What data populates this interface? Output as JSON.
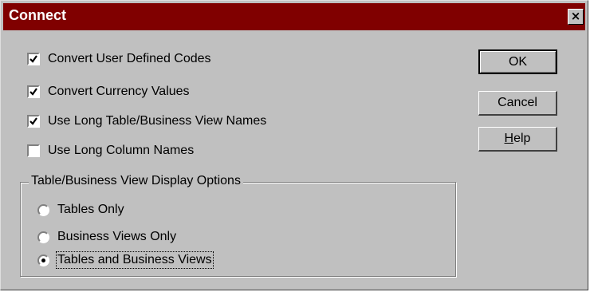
{
  "window": {
    "title": "Connect",
    "close_glyph": "×"
  },
  "options": {
    "checkboxes": [
      {
        "label": "Convert User Defined Codes",
        "checked": true
      },
      {
        "label": "Convert Currency Values",
        "checked": true
      },
      {
        "label": "Use Long Table/Business View Names",
        "checked": true
      },
      {
        "label": "Use Long Column Names",
        "checked": false
      }
    ]
  },
  "buttons": {
    "ok": "OK",
    "cancel": "Cancel",
    "help_mnemonic": "H",
    "help_rest": "elp"
  },
  "display_options": {
    "title": "Table/Business View Display Options",
    "radios": [
      {
        "label": "Tables Only",
        "selected": false
      },
      {
        "label": "Business Views Only",
        "selected": false
      },
      {
        "label": "Tables and Business Views",
        "selected": true
      }
    ]
  },
  "colors": {
    "titlebar": "#800000",
    "dialog_face": "#c0c0c0"
  }
}
